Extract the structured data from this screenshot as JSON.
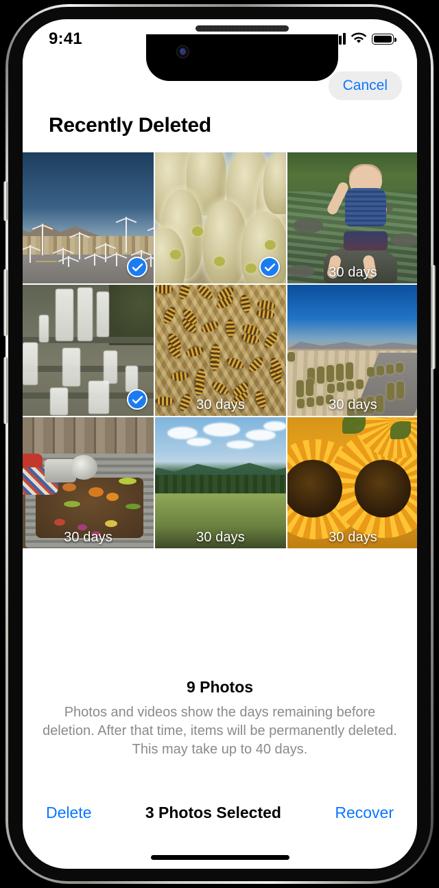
{
  "device": {
    "frame_label": "iphone-frame",
    "side_buttons": [
      "action-button",
      "volume-down-button",
      "volume-up-button",
      "power-button"
    ]
  },
  "status_bar": {
    "time": "9:41",
    "cellular_icon": "cellular-bars-icon",
    "wifi_icon": "wifi-icon",
    "battery_icon": "battery-full-icon"
  },
  "nav": {
    "cancel_label": "Cancel",
    "title": "Recently Deleted"
  },
  "grid": {
    "columns": 3,
    "photos": [
      {
        "id": 1,
        "subject": "Wind turbines along a desert highway",
        "art": "art-turbines",
        "days_label": "",
        "selected": true
      },
      {
        "id": 2,
        "subject": "Cholla cactus close-up",
        "art": "art-cactus",
        "days_label": "",
        "selected": true
      },
      {
        "id": 3,
        "subject": "Baby sitting on a rock in a creek",
        "art": "art-baby",
        "days_label": "30 days",
        "selected": false
      },
      {
        "id": 4,
        "subject": "Cascading waterfall over rock ledges",
        "art": "art-falls",
        "days_label": "",
        "selected": true
      },
      {
        "id": 5,
        "subject": "Honeybees on honeycomb",
        "art": "art-bees",
        "days_label": "30 days",
        "selected": false
      },
      {
        "id": 6,
        "subject": "Desert road through cactus field",
        "art": "art-desertroad",
        "days_label": "30 days",
        "selected": false
      },
      {
        "id": 7,
        "subject": "Compost bin with food scraps",
        "art": "art-compost",
        "days_label": "30 days",
        "selected": false
      },
      {
        "id": 8,
        "subject": "Green meadow below forested mountains",
        "art": "art-meadow",
        "days_label": "30 days",
        "selected": false
      },
      {
        "id": 9,
        "subject": "Two sunflowers in bloom",
        "art": "art-sunflowers",
        "days_label": "30 days",
        "selected": false
      }
    ]
  },
  "footer": {
    "photo_count": "9 Photos",
    "description": "Photos and videos show the days remaining before deletion. After that time, items will be permanently deleted. This may take up to 40 days."
  },
  "toolbar": {
    "delete_label": "Delete",
    "selection_label": "3 Photos Selected",
    "recover_label": "Recover"
  },
  "colors": {
    "accent_blue": "#0a76ff",
    "check_blue": "#1b7cf2",
    "secondary_text": "#8a8a8e",
    "cancel_chip_bg": "#ededed"
  }
}
